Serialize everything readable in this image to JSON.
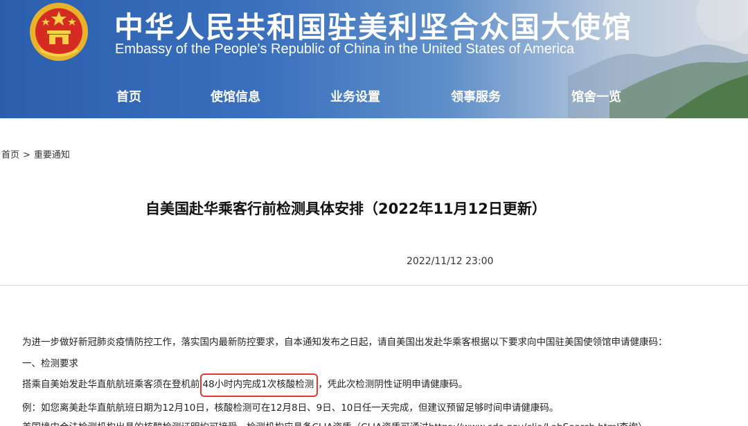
{
  "header": {
    "title_cn": "中华人民共和国驻美利坚合众国大使馆",
    "title_en": "Embassy of the People's Republic of China in the United States of America"
  },
  "nav": {
    "items": [
      {
        "label": "首页"
      },
      {
        "label": "使馆信息"
      },
      {
        "label": "业务设置"
      },
      {
        "label": "领事服务"
      },
      {
        "label": "馆舍一览"
      }
    ]
  },
  "breadcrumb": {
    "home": "首页",
    "separator": ">",
    "current": "重要通知"
  },
  "article": {
    "title": "自美国赴华乘客行前检测具体安排（2022年11月12日更新）",
    "date": "2022/11/12 23:00",
    "paragraphs": {
      "intro": "为进一步做好新冠肺炎疫情防控工作，落实国内最新防控要求，自本通知发布之日起，请自美国出发赴华乘客根据以下要求向中国驻美国使领馆申请健康码：",
      "section1": "一、检测要求",
      "req_before": "搭乘自美始发赴华直航航班乘客须在登机前",
      "req_highlight": "48小时内完成1次核酸检测",
      "req_after": "，凭此次检测阴性证明申请健康码。",
      "example": "例：如您离美赴华直航航班日期为12月10日，核酸检测可在12月8日、9日、10日任一天完成，但建议预留足够时间申请健康码。",
      "cut_line": "美国境内合法检测机构出具的核酸检测证明均可接受，检测机构应具备CLIA资质（CLIA资质可通过https://www.cdc.gov/clia/LabSearch.html查询）"
    }
  },
  "colors": {
    "banner_blue": "#2b5fae",
    "highlight_red": "#e03a2f"
  }
}
